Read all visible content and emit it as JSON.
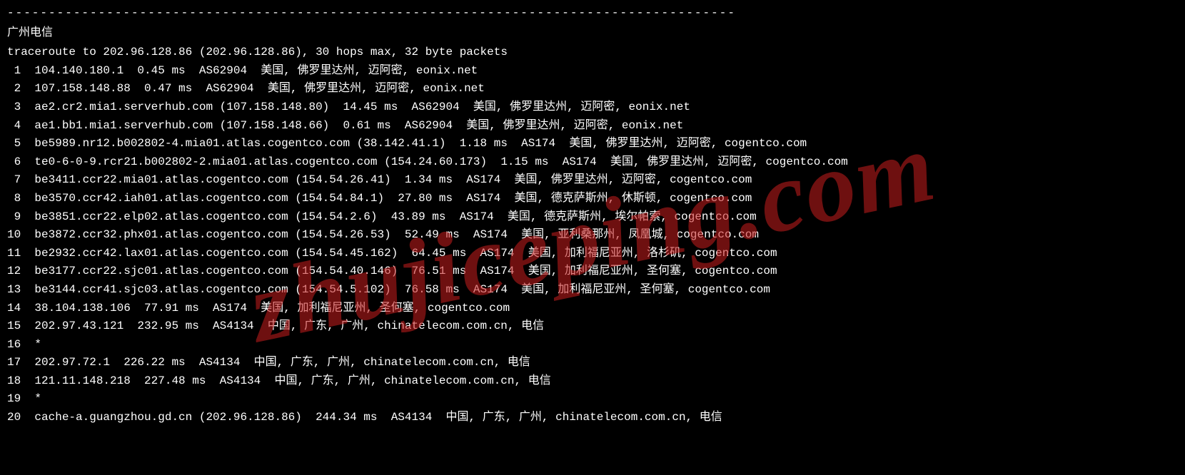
{
  "divider": "----------------------------------------------------------------------------------------",
  "title": "广州电信",
  "header": "traceroute to 202.96.128.86 (202.96.128.86), 30 hops max, 32 byte packets",
  "watermark": "zhujiceping.com",
  "hops": [
    {
      "n": 1,
      "line": " 1  104.140.180.1  0.45 ms  AS62904  美国, 佛罗里达州, 迈阿密, eonix.net"
    },
    {
      "n": 2,
      "line": " 2  107.158.148.88  0.47 ms  AS62904  美国, 佛罗里达州, 迈阿密, eonix.net"
    },
    {
      "n": 3,
      "line": " 3  ae2.cr2.mia1.serverhub.com (107.158.148.80)  14.45 ms  AS62904  美国, 佛罗里达州, 迈阿密, eonix.net"
    },
    {
      "n": 4,
      "line": " 4  ae1.bb1.mia1.serverhub.com (107.158.148.66)  0.61 ms  AS62904  美国, 佛罗里达州, 迈阿密, eonix.net"
    },
    {
      "n": 5,
      "line": " 5  be5989.nr12.b002802-4.mia01.atlas.cogentco.com (38.142.41.1)  1.18 ms  AS174  美国, 佛罗里达州, 迈阿密, cogentco.com"
    },
    {
      "n": 6,
      "line": " 6  te0-6-0-9.rcr21.b002802-2.mia01.atlas.cogentco.com (154.24.60.173)  1.15 ms  AS174  美国, 佛罗里达州, 迈阿密, cogentco.com"
    },
    {
      "n": 7,
      "line": " 7  be3411.ccr22.mia01.atlas.cogentco.com (154.54.26.41)  1.34 ms  AS174  美国, 佛罗里达州, 迈阿密, cogentco.com"
    },
    {
      "n": 8,
      "line": " 8  be3570.ccr42.iah01.atlas.cogentco.com (154.54.84.1)  27.80 ms  AS174  美国, 德克萨斯州, 休斯顿, cogentco.com"
    },
    {
      "n": 9,
      "line": " 9  be3851.ccr22.elp02.atlas.cogentco.com (154.54.2.6)  43.89 ms  AS174  美国, 德克萨斯州, 埃尔帕索, cogentco.com"
    },
    {
      "n": 10,
      "line": "10  be3872.ccr32.phx01.atlas.cogentco.com (154.54.26.53)  52.49 ms  AS174  美国, 亚利桑那州, 凤凰城, cogentco.com"
    },
    {
      "n": 11,
      "line": "11  be2932.ccr42.lax01.atlas.cogentco.com (154.54.45.162)  64.45 ms  AS174  美国, 加利福尼亚州, 洛杉矶, cogentco.com"
    },
    {
      "n": 12,
      "line": "12  be3177.ccr22.sjc01.atlas.cogentco.com (154.54.40.146)  76.51 ms  AS174  美国, 加利福尼亚州, 圣何塞, cogentco.com"
    },
    {
      "n": 13,
      "line": "13  be3144.ccr41.sjc03.atlas.cogentco.com (154.54.5.102)  76.58 ms  AS174  美国, 加利福尼亚州, 圣何塞, cogentco.com"
    },
    {
      "n": 14,
      "line": "14  38.104.138.106  77.91 ms  AS174  美国, 加利福尼亚州, 圣何塞, cogentco.com"
    },
    {
      "n": 15,
      "line": "15  202.97.43.121  232.95 ms  AS4134  中国, 广东, 广州, chinatelecom.com.cn, 电信"
    },
    {
      "n": 16,
      "line": "16  *"
    },
    {
      "n": 17,
      "line": "17  202.97.72.1  226.22 ms  AS4134  中国, 广东, 广州, chinatelecom.com.cn, 电信"
    },
    {
      "n": 18,
      "line": "18  121.11.148.218  227.48 ms  AS4134  中国, 广东, 广州, chinatelecom.com.cn, 电信"
    },
    {
      "n": 19,
      "line": "19  *"
    },
    {
      "n": 20,
      "line": "20  cache-a.guangzhou.gd.cn (202.96.128.86)  244.34 ms  AS4134  中国, 广东, 广州, chinatelecom.com.cn, 电信"
    }
  ]
}
